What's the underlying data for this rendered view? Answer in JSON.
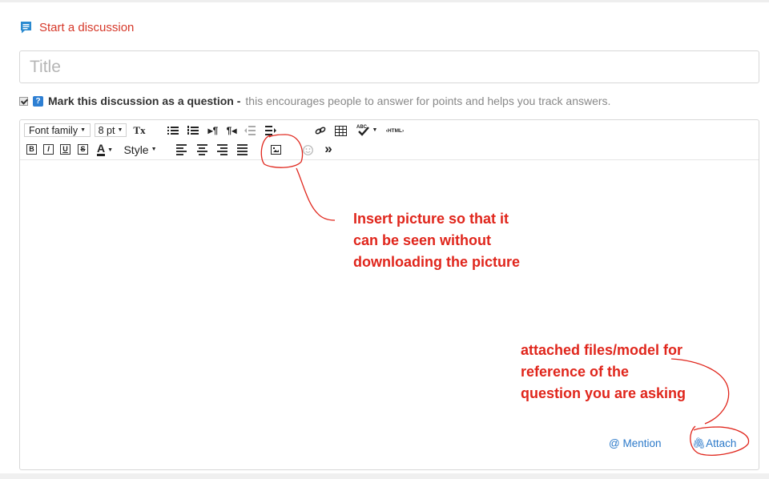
{
  "header": {
    "title": "Start a discussion",
    "icon": "discussion-icon"
  },
  "title_field": {
    "placeholder": "Title",
    "value": ""
  },
  "question": {
    "checked": true,
    "label": "Mark this discussion as a question -",
    "hint": "this encourages people to answer for points and helps you track answers."
  },
  "toolbar": {
    "font_family": "Font family",
    "font_size": "8 pt",
    "clear_format": "Tx",
    "style": "Style",
    "html": "‹HTML›",
    "bold": "B",
    "italic": "I",
    "underline": "U",
    "strike": "S",
    "font_color": "A",
    "more": "»"
  },
  "footer": {
    "mention": "@ Mention",
    "attach": "Attach"
  },
  "annotations": {
    "insert_picture": [
      "Insert picture so that it",
      "can be seen without",
      "downloading the picture"
    ],
    "attached_files": [
      "attached files/model for",
      "reference of the",
      "question you are asking"
    ]
  },
  "colors": {
    "accent_red": "#d6392a",
    "link_blue": "#2b79c9",
    "annotation_red": "#e0261c"
  }
}
